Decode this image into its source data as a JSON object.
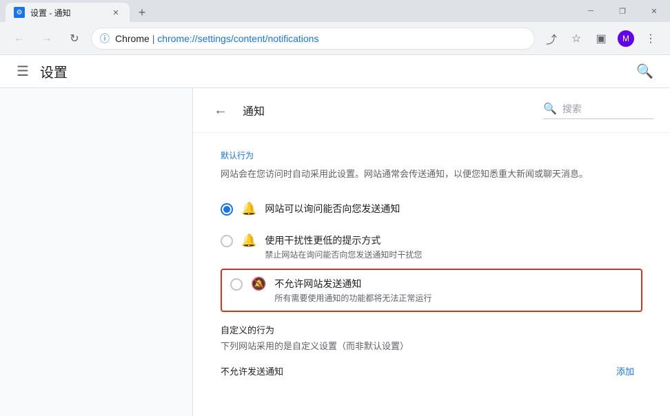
{
  "titlebar": {
    "tab_icon": "⚙",
    "tab_title": "设置 - 通知",
    "tab_close": "✕",
    "new_tab": "+",
    "controls": {
      "minimize": "─",
      "maximize": "□",
      "restore": "❐",
      "close": "✕"
    }
  },
  "toolbar": {
    "back": "←",
    "forward": "→",
    "reload": "↻",
    "brand": "Chrome",
    "address": "chrome://settings/content/notifications",
    "share_icon": "⤴",
    "star_icon": "☆",
    "split_icon": "▣",
    "profile_icon": "👤",
    "menu_icon": "⋮"
  },
  "header": {
    "hamburger": "☰",
    "title": "设置",
    "search_icon": "🔍"
  },
  "notifications": {
    "back_icon": "←",
    "title": "通知",
    "search_placeholder": "搜索",
    "search_icon": "🔍",
    "default_behavior_label": "默认行为",
    "default_desc": "网站会在您访问时自动采用此设置。网站通常会传送通知，以便您知悉重大新闻或聊天消息。",
    "options": [
      {
        "id": "allow",
        "checked": true,
        "icon": "🔔",
        "muted": false,
        "main": "网站可以询问能否向您发送通知",
        "sub": ""
      },
      {
        "id": "quiet",
        "checked": false,
        "icon": "🔔",
        "muted": false,
        "main": "使用干扰性更低的提示方式",
        "sub": "禁止网站在询问能否向您发送通知时干扰您"
      },
      {
        "id": "block",
        "checked": false,
        "icon": "🔕",
        "muted": true,
        "main": "不允许网站发送通知",
        "sub": "所有需要使用通知的功能都将无法正常运行",
        "highlighted": true
      }
    ],
    "custom_behavior_label": "自定义的行为",
    "custom_desc": "下列网站采用的是自定义设置（而非默认设置）",
    "block_notifications_label": "不允许发送通知",
    "add_button": "添加"
  }
}
